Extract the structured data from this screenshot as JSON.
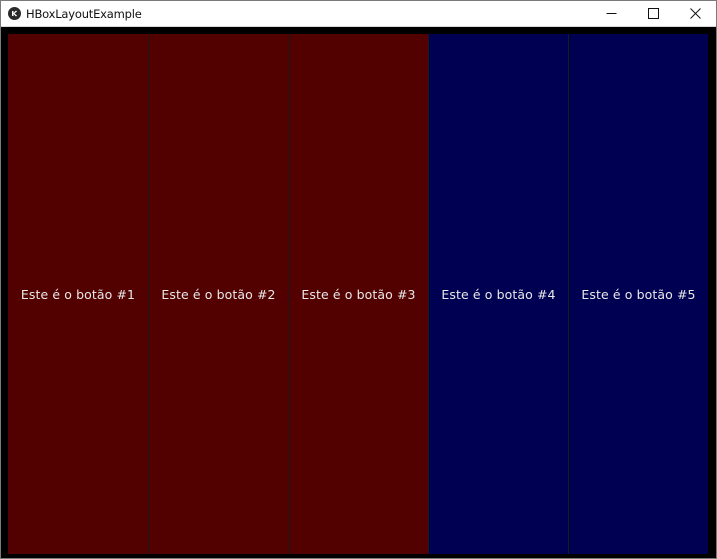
{
  "window": {
    "title": "HBoxLayoutExample",
    "app_icon": "kivy-logo-icon",
    "controls": [
      "minimize-icon",
      "maximize-icon",
      "close-icon"
    ]
  },
  "layout": {
    "buttons": [
      {
        "label": "Este é o botão #1",
        "color": "#520000"
      },
      {
        "label": "Este é o botão #2",
        "color": "#520000"
      },
      {
        "label": "Este é o botão #3",
        "color": "#520000"
      },
      {
        "label": "Este é o botão #4",
        "color": "#000052"
      },
      {
        "label": "Este é o botão #5",
        "color": "#000052"
      }
    ]
  }
}
